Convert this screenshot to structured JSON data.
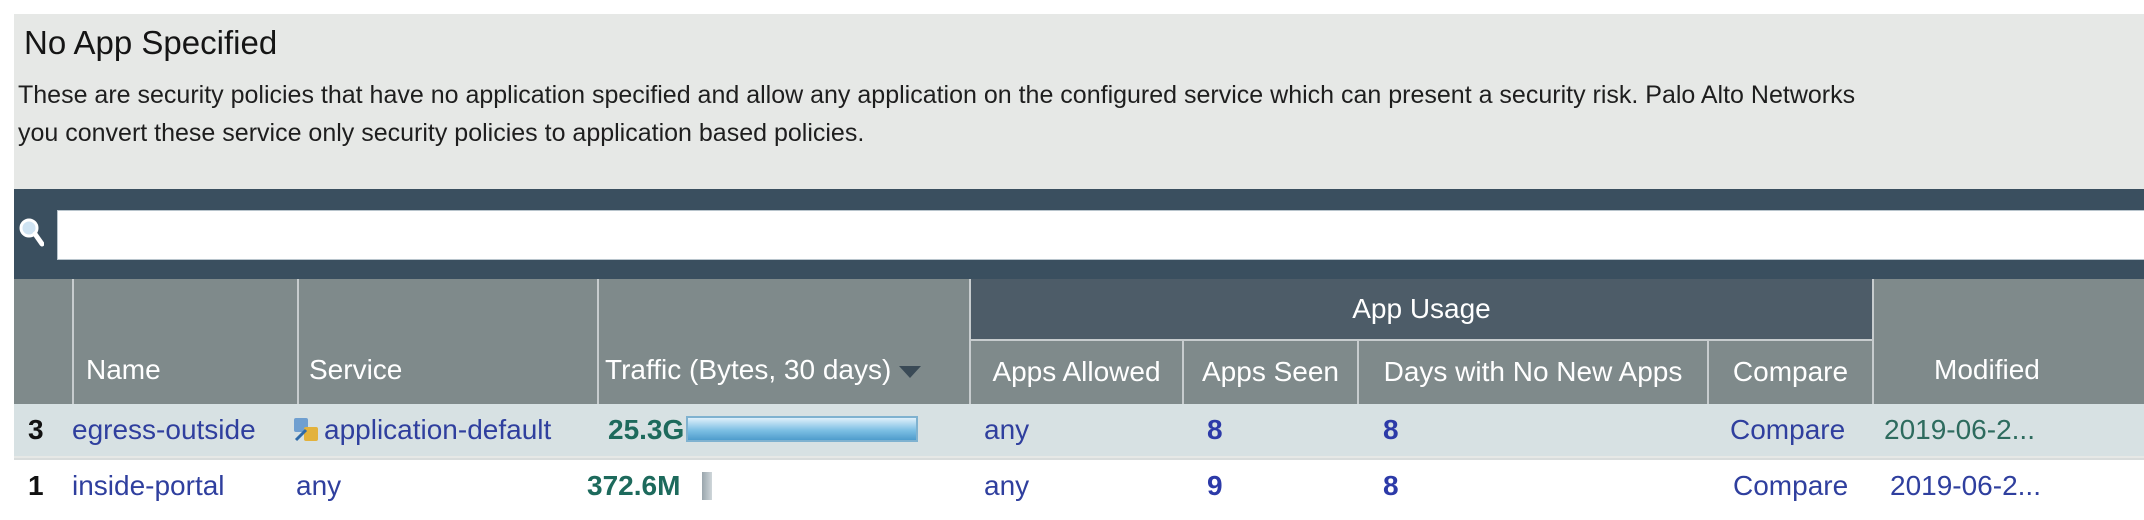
{
  "header": {
    "title": "No App Specified",
    "description_line1": "These are security policies that have no application specified and allow any application on the configured service which can present a security risk. Palo Alto Networks",
    "description_line2": "you convert these service only security policies to application based policies."
  },
  "search": {
    "icon": "search-icon",
    "value": ""
  },
  "table": {
    "columns": {
      "name": "Name",
      "service": "Service",
      "traffic": "Traffic (Bytes, 30 days)",
      "app_usage": "App Usage",
      "apps_allowed": "Apps Allowed",
      "apps_seen": "Apps Seen",
      "days_no_new_apps": "Days with No New Apps",
      "compare": "Compare",
      "modified": "Modified"
    },
    "rows": [
      {
        "rank": "3",
        "name": "egress-outside",
        "service": "application-default",
        "service_icon": "application-default-icon",
        "traffic": "25.3G",
        "traffic_fraction": 1.0,
        "apps_allowed": "any",
        "apps_seen": "8",
        "days_no_new_apps": "8",
        "compare": "Compare",
        "modified": "2019-06-2..."
      },
      {
        "rank": "1",
        "name": "inside-portal",
        "service": "any",
        "traffic": "372.6M",
        "traffic_fraction": 0.015,
        "apps_allowed": "any",
        "apps_seen": "9",
        "days_no_new_apps": "8",
        "compare": "Compare",
        "modified": "2019-06-2..."
      }
    ]
  },
  "colors": {
    "search_bar": "#3a4f5f",
    "header_bg": "#7f8a8b",
    "group_header_bg": "#4d5c68",
    "link": "#2f3f9e",
    "traffic_text": "#1d6a5c",
    "bar_fill": "#7ec0e4"
  }
}
